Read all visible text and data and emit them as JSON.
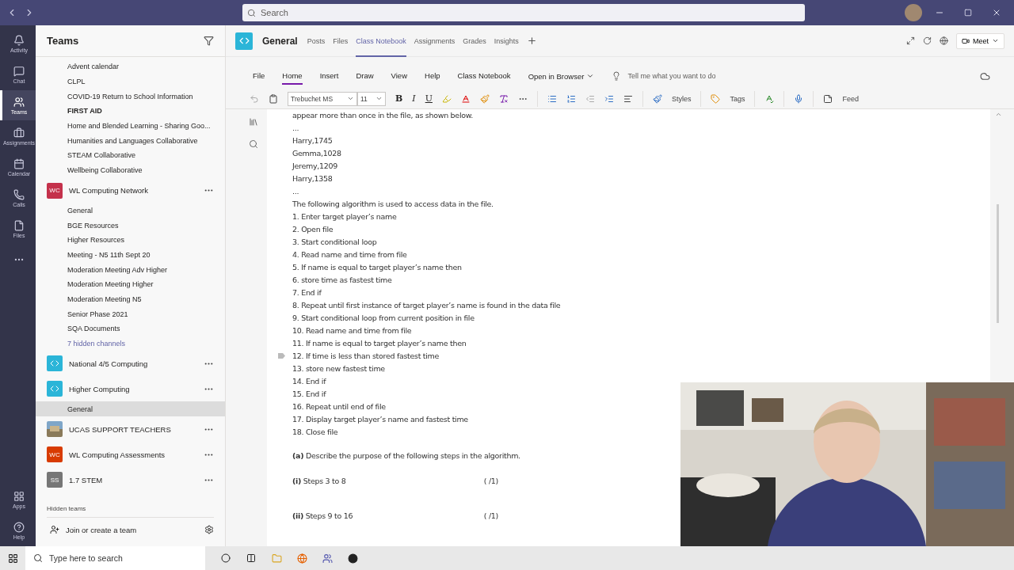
{
  "title_bar": {
    "search_placeholder": "Search"
  },
  "rail": {
    "items": [
      {
        "label": "Activity",
        "selected": false
      },
      {
        "label": "Chat",
        "selected": false
      },
      {
        "label": "Teams",
        "selected": true
      },
      {
        "label": "Assignments",
        "selected": false
      },
      {
        "label": "Calendar",
        "selected": false
      },
      {
        "label": "Calls",
        "selected": false
      },
      {
        "label": "Files",
        "selected": false
      }
    ],
    "bottom": [
      {
        "label": "Apps"
      },
      {
        "label": "Help"
      }
    ]
  },
  "teams_panel": {
    "title": "Teams",
    "items": [
      {
        "kind": "channel",
        "label": "Advent calendar",
        "selected": false,
        "unread": false
      },
      {
        "kind": "channel",
        "label": "CLPL",
        "selected": false,
        "unread": false
      },
      {
        "kind": "channel",
        "label": "COVID-19 Return to School Information",
        "selected": false,
        "unread": false
      },
      {
        "kind": "channel",
        "label": "FIRST AID",
        "selected": false,
        "unread": true
      },
      {
        "kind": "channel",
        "label": "Home and Blended Learning - Sharing Goo...",
        "selected": false,
        "unread": false
      },
      {
        "kind": "channel",
        "label": "Humanities and Languages Collaborative",
        "selected": false,
        "unread": false
      },
      {
        "kind": "channel",
        "label": "STEAM Collaborative",
        "selected": false,
        "unread": false
      },
      {
        "kind": "channel",
        "label": "Wellbeing Collaborative",
        "selected": false,
        "unread": false
      },
      {
        "kind": "team",
        "label": "WL Computing Network",
        "avatar": {
          "kind": "initials",
          "text": "WC",
          "color": "#c4314b"
        }
      },
      {
        "kind": "channel",
        "label": "General",
        "selected": false,
        "unread": false
      },
      {
        "kind": "channel",
        "label": "BGE Resources",
        "selected": false,
        "unread": false
      },
      {
        "kind": "channel",
        "label": "Higher Resources",
        "selected": false,
        "unread": false
      },
      {
        "kind": "channel",
        "label": "Meeting - N5 11th Sept 20",
        "selected": false,
        "unread": false
      },
      {
        "kind": "channel",
        "label": "Moderation Meeting Adv Higher",
        "selected": false,
        "unread": false
      },
      {
        "kind": "channel",
        "label": "Moderation Meeting Higher",
        "selected": false,
        "unread": false
      },
      {
        "kind": "channel",
        "label": "Moderation Meeting N5",
        "selected": false,
        "unread": false
      },
      {
        "kind": "channel",
        "label": "Senior Phase 2021",
        "selected": false,
        "unread": false
      },
      {
        "kind": "channel",
        "label": "SQA Documents",
        "selected": false,
        "unread": false
      },
      {
        "kind": "link",
        "label": "7 hidden channels"
      },
      {
        "kind": "team",
        "label": "National 4/5 Computing",
        "avatar": {
          "kind": "code",
          "color": "#2bb5d8"
        }
      },
      {
        "kind": "team",
        "label": "Higher Computing",
        "avatar": {
          "kind": "code",
          "color": "#2bb5d8"
        }
      },
      {
        "kind": "channel",
        "label": "General",
        "selected": true,
        "unread": false
      },
      {
        "kind": "team",
        "label": "UCAS SUPPORT TEACHERS"
      },
      {
        "kind": "team",
        "label": "WL Computing Assessments",
        "avatar": {
          "kind": "initials",
          "text": "WC",
          "color": "#d83b01"
        }
      },
      {
        "kind": "team",
        "label": "1.7 STEM",
        "avatar": {
          "kind": "initials",
          "text": "SS",
          "color": "#767676"
        }
      }
    ],
    "hidden_teams": "Hidden teams",
    "join": "Join or create a team"
  },
  "channel_header": {
    "title": "General",
    "tabs": [
      {
        "label": "Posts",
        "selected": false
      },
      {
        "label": "Files",
        "selected": false
      },
      {
        "label": "Class Notebook",
        "selected": true
      },
      {
        "label": "Assignments",
        "selected": false
      },
      {
        "label": "Grades",
        "selected": false
      },
      {
        "label": "Insights",
        "selected": false
      }
    ],
    "meet": "Meet"
  },
  "ribbon": {
    "tabs": [
      {
        "label": "File",
        "selected": false
      },
      {
        "label": "Home",
        "selected": true
      },
      {
        "label": "Insert",
        "selected": false
      },
      {
        "label": "Draw",
        "selected": false
      },
      {
        "label": "View",
        "selected": false
      },
      {
        "label": "Help",
        "selected": false
      },
      {
        "label": "Class Notebook",
        "selected": false
      }
    ],
    "open_in_browser": "Open in Browser",
    "tell_me_placeholder": "Tell me what you want to do",
    "font": "Trebuchet MS",
    "size": "11",
    "bold": "B",
    "italic": "I",
    "underline": "U",
    "styles": "Styles",
    "tags": "Tags",
    "feed": "Feed"
  },
  "document": {
    "lines": [
      {
        "kind": "line",
        "text": "appear more than once in the file, as shown below."
      },
      {
        "kind": "line",
        "text": "..."
      },
      {
        "kind": "line",
        "text": "Harry,1745"
      },
      {
        "kind": "line",
        "text": "Gemma,1028"
      },
      {
        "kind": "line",
        "text": "Jeremy,1209"
      },
      {
        "kind": "line",
        "text": "Harry,1358"
      },
      {
        "kind": "line",
        "text": "..."
      },
      {
        "kind": "line",
        "text": "The following algorithm is used to access data in the file."
      },
      {
        "kind": "line",
        "text": "1. Enter target player’s name"
      },
      {
        "kind": "line",
        "text": "2. Open file"
      },
      {
        "kind": "line",
        "text": "3. Start conditional loop"
      },
      {
        "kind": "line",
        "text": "4. Read name and time from file"
      },
      {
        "kind": "line",
        "text": "5. If name is equal to target player’s name then"
      },
      {
        "kind": "line",
        "text": "6. store time as fastest time"
      },
      {
        "kind": "line",
        "text": "7. End if"
      },
      {
        "kind": "line",
        "text": "8. Repeat until first instance of target player’s name is found in the data file"
      },
      {
        "kind": "line",
        "text": "9. Start conditional loop from current position in file"
      },
      {
        "kind": "line",
        "text": "10. Read name and time from file"
      },
      {
        "kind": "line",
        "text": "11. If name is equal to target player’s name then"
      },
      {
        "kind": "line",
        "text": "12. If time is less than stored fastest time",
        "handle": true
      },
      {
        "kind": "line",
        "text": "13. store new fastest time"
      },
      {
        "kind": "line",
        "text": "14. End if"
      },
      {
        "kind": "line",
        "text": "15. End if"
      },
      {
        "kind": "line",
        "text": "16. Repeat until end of file"
      },
      {
        "kind": "line",
        "text": "17. Display target player’s name and fastest time"
      },
      {
        "kind": "line",
        "text": "18. Close file"
      },
      {
        "kind": "question",
        "text": "**(a)** Describe the purpose of the following steps in the algorithm."
      },
      {
        "kind": "part",
        "text": "**(i)** Steps 3 to 8",
        "marks": "( /1)"
      },
      {
        "kind": "part",
        "text": "**(ii)** Steps 9 to 16",
        "marks": "( /1)"
      }
    ]
  },
  "taskbar": {
    "search_placeholder": "Type here to search"
  }
}
